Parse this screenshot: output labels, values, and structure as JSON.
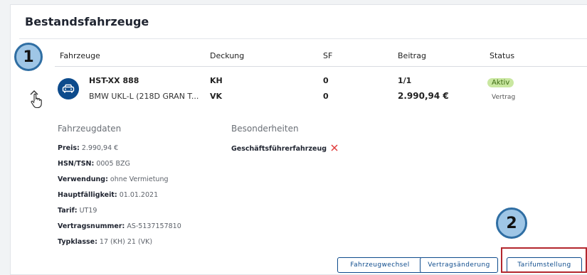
{
  "card": {
    "title": "Bestandsfahrzeuge"
  },
  "table": {
    "headers": {
      "fahrzeuge": "Fahrzeuge",
      "deckung": "Deckung",
      "sf": "SF",
      "beitrag": "Beitrag",
      "status": "Status"
    },
    "row": {
      "plate": "HST-XX 888",
      "model": "BMW UKL-L (218D GRAN T...",
      "deckung1": "KH",
      "deckung2": "VK",
      "sf1": "0",
      "sf2": "0",
      "beitrag1": "1/1",
      "beitrag2": "2.990,94 €",
      "status": "Aktiv",
      "status_sub": "Vertrag"
    }
  },
  "details": {
    "fahrzeugdaten_title": "Fahrzeugdaten",
    "besonderheiten_title": "Besonderheiten",
    "items": [
      {
        "key": "Preis:",
        "value": "2.990,94 €"
      },
      {
        "key": "HSN/TSN:",
        "value": "0005 BZG"
      },
      {
        "key": "Verwendung:",
        "value": "ohne Vermietung"
      },
      {
        "key": "Hauptfälligkeit:",
        "value": "01.01.2021"
      },
      {
        "key": "Tarif:",
        "value": "UT19"
      },
      {
        "key": "Vertragsnummer:",
        "value": "AS-5137157810"
      },
      {
        "key": "Typklasse:",
        "value": "17 (KH) 21 (VK)"
      }
    ],
    "besonderheit": "Geschäftsführerfahrzeug"
  },
  "buttons": {
    "fahrzeugwechsel": "Fahrzeugwechsel",
    "vertragsaenderung": "Vertragsänderung",
    "tarifumstellung": "Tarifumstellung"
  },
  "callouts": {
    "one": "1",
    "two": "2"
  },
  "colors": {
    "primary": "#0d4b8c",
    "status_bg": "#c9e7a0",
    "status_text": "#3d6b12",
    "highlight": "#b3262d",
    "callout_fill": "#9fc6e6",
    "remove_x": "#e03c3c"
  },
  "icons": [
    "car-icon",
    "chevron-up-icon",
    "hand-cursor-icon",
    "close-icon"
  ]
}
